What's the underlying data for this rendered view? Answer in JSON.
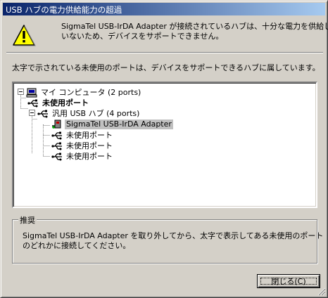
{
  "window": {
    "title": "USB ハブの電力供給能力の超過"
  },
  "message": {
    "line1": "SigmaTel USB-IrDA Adapter が接続されているハブは、十分な電力を供給して",
    "line2": "いないため、デバイスをサポートできません。"
  },
  "instruction": "太字で示されている未使用のポートは、デバイスをサポートできるハブに属しています。",
  "tree": {
    "computer": "マイ コンピュータ (2 ports)",
    "unused_bold": "未使用ポート",
    "hub": "汎用 USB ハブ (4 ports)",
    "device": "SigmaTel USB-IrDA Adapter",
    "unused_1": "未使用ポート",
    "unused_2": "未使用ポート",
    "unused_3": "未使用ポート"
  },
  "recommendation": {
    "title": "推奨",
    "line1": "SigmaTel USB-IrDA Adapter を取り外してから、太字で表示してある未使用のポート",
    "line2": "のどれかに接続してください。"
  },
  "buttons": {
    "close": "閉じる(C)"
  },
  "icons": {
    "warning": "warning-icon",
    "computer": "computer-icon",
    "usb_port": "usb-port-icon",
    "device": "usb-device-icon",
    "expander": "tree-collapse-icon"
  },
  "colors": {
    "titlebar_start": "#0a246a",
    "titlebar_end": "#a6caf0",
    "face": "#d4d0c8",
    "selection": "#c0c0c0"
  }
}
